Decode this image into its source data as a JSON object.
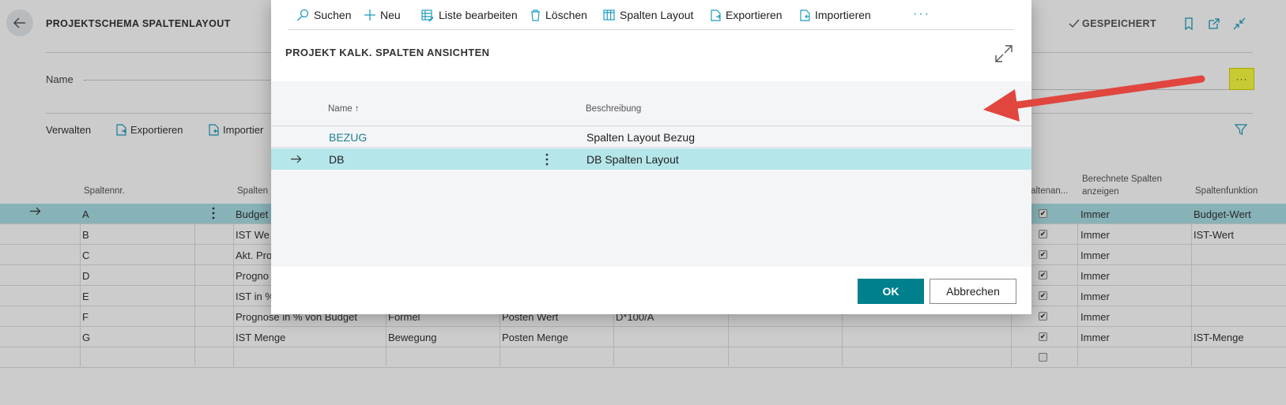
{
  "background": {
    "page_title": "PROJEKTSCHEMA SPALTENLAYOUT",
    "saved_label": "GESPEICHERT",
    "name_label": "Name",
    "ellipsis_label": "···",
    "actions": [
      "Verwalten",
      "Exportieren",
      "Importier"
    ],
    "grid": {
      "headers": {
        "col1": "Spaltennr.",
        "col2": "Spalten",
        "col_sichtbar": "Spaltenan...",
        "col_berechnet_1": "Berechnete Spalten",
        "col_berechnet_2": "anzeigen",
        "col_funktion": "Spaltenfunktion"
      },
      "rows": [
        {
          "nr": "A",
          "name": "Budget",
          "c3": "",
          "c4": "",
          "c5": "",
          "checked": true,
          "berechnet": "Immer",
          "funktion": "Budget-Wert"
        },
        {
          "nr": "B",
          "name": "IST We",
          "c3": "",
          "c4": "",
          "c5": "",
          "checked": true,
          "berechnet": "Immer",
          "funktion": "IST-Wert"
        },
        {
          "nr": "C",
          "name": "Akt. Pro",
          "c3": "",
          "c4": "",
          "c5": "",
          "checked": true,
          "berechnet": "Immer",
          "funktion": ""
        },
        {
          "nr": "D",
          "name": "Progno",
          "c3": "",
          "c4": "",
          "c5": "",
          "checked": true,
          "berechnet": "Immer",
          "funktion": ""
        },
        {
          "nr": "E",
          "name": "IST in %",
          "c3": "",
          "c4": "",
          "c5": "",
          "checked": true,
          "berechnet": "Immer",
          "funktion": ""
        },
        {
          "nr": "F",
          "name": "Prognose in % von Budget",
          "c3": "Formel",
          "c4": "Posten Wert",
          "c5": "D*100/A",
          "checked": true,
          "berechnet": "Immer",
          "funktion": ""
        },
        {
          "nr": "G",
          "name": "IST Menge",
          "c3": "Bewegung",
          "c4": "Posten Menge",
          "c5": "",
          "checked": true,
          "berechnet": "Immer",
          "funktion": "IST-Menge"
        },
        {
          "nr": "",
          "name": "",
          "c3": "",
          "c4": "",
          "c5": "",
          "checked": false,
          "berechnet": "",
          "funktion": ""
        }
      ]
    }
  },
  "dialog": {
    "toolbar": {
      "search": "Suchen",
      "new": "Neu",
      "edit_list": "Liste bearbeiten",
      "delete": "Löschen",
      "column_layout": "Spalten Layout",
      "export": "Exportieren",
      "import": "Importieren",
      "more": "···"
    },
    "title": "PROJEKT KALK. SPALTEN ANSICHTEN",
    "columns": {
      "name": "Name ↑",
      "description": "Beschreibung"
    },
    "rows": [
      {
        "name": "BEZUG",
        "description": "Spalten Layout Bezug",
        "selected": false
      },
      {
        "name": "DB",
        "description": "DB Spalten Layout",
        "selected": true
      }
    ],
    "ok_label": "OK",
    "cancel_label": "Abbrechen"
  },
  "colors": {
    "accent": "#00808c",
    "link": "#1d7f8f",
    "selected_row": "#b5e6ea",
    "highlight": "#fbfd42",
    "annotation_arrow": "#e0463e"
  },
  "icons": [
    "back-arrow-icon",
    "check-icon",
    "bookmark-icon",
    "open-new-icon",
    "collapse-icon",
    "search-icon",
    "plus-icon",
    "edit-list-icon",
    "trash-icon",
    "columns-icon",
    "export-icon",
    "import-icon",
    "expand-icon",
    "filter-icon",
    "row-arrow-icon",
    "more-vertical-icon"
  ]
}
